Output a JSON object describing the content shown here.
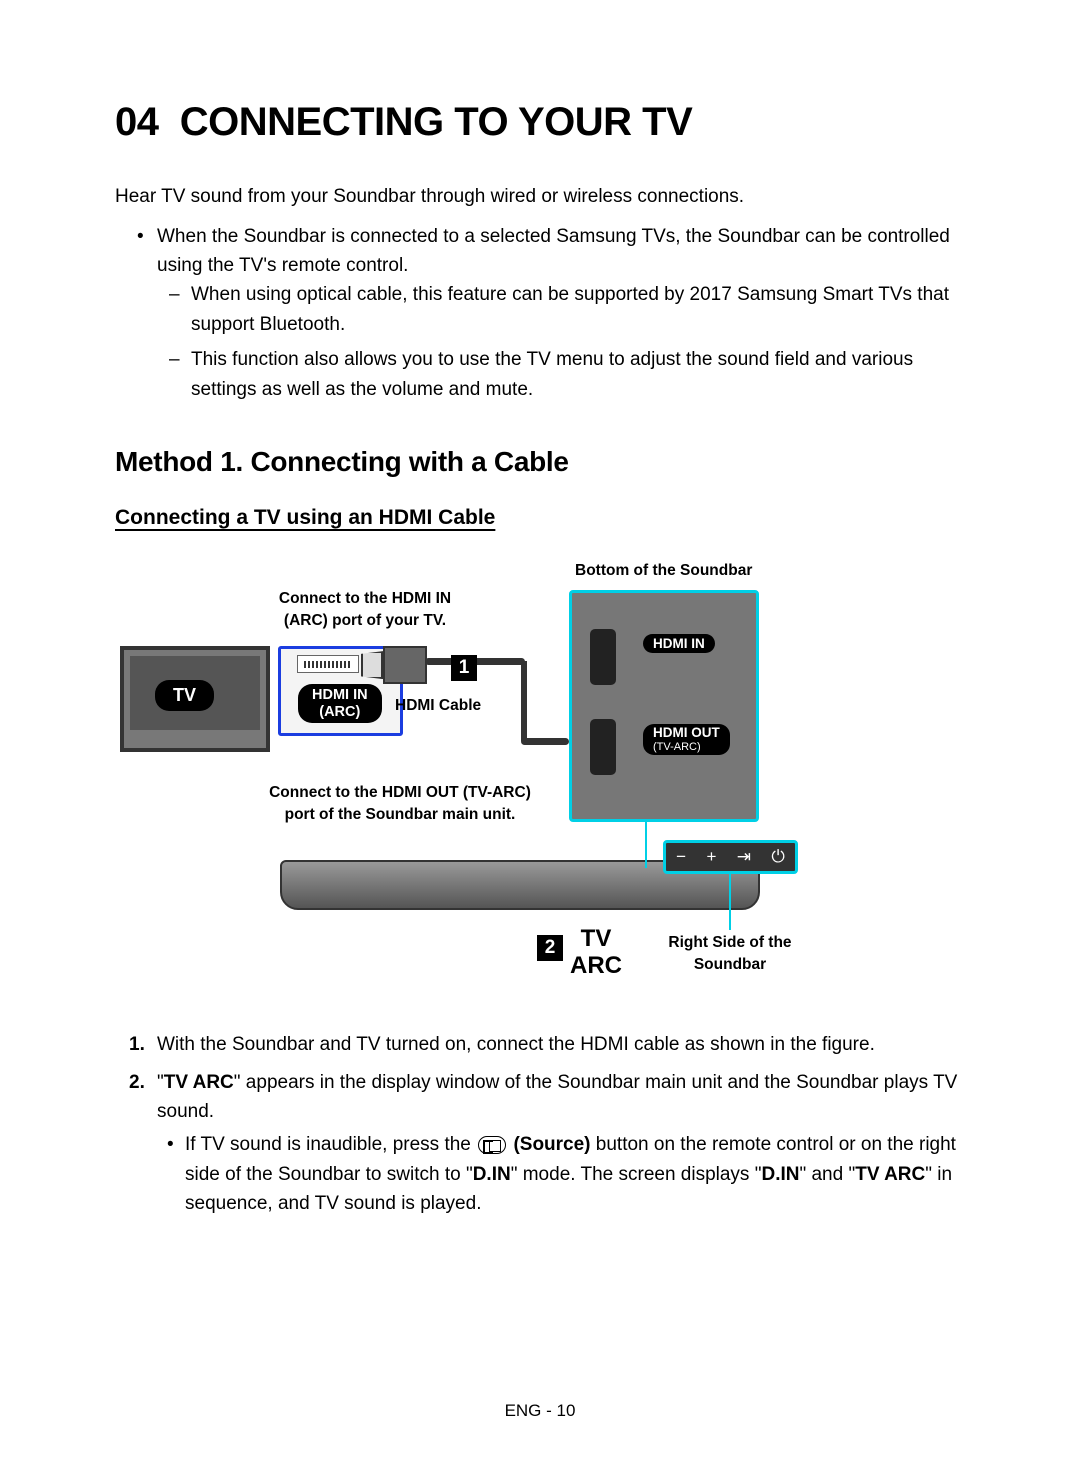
{
  "heading_num": "04",
  "heading_title": "CONNECTING TO YOUR TV",
  "intro": "Hear TV sound from your Soundbar through wired or wireless connections.",
  "bullet1": "When the Soundbar is connected to a selected Samsung TVs, the Soundbar can be controlled using the TV's remote control.",
  "dash1": "When using optical cable, this feature can be supported by 2017 Samsung Smart TVs that support Bluetooth.",
  "dash2": "This function also allows you to use the TV menu to adjust the sound field and various settings as well as the volume and mute.",
  "method_heading": "Method 1. Connecting with a Cable",
  "subsub_heading": "Connecting a TV using an HDMI Cable",
  "diagram": {
    "soundbar_bottom_caption": "Bottom of the Soundbar",
    "connect_hdmi_in_1": "Connect to the HDMI IN",
    "connect_hdmi_in_2": "(ARC) port of your TV.",
    "tv_label": "TV",
    "hdmi_in_arc_1": "HDMI IN",
    "hdmi_in_arc_2": "(ARC)",
    "hdmi_cable": "HDMI Cable",
    "connect_hdmi_out_1": "Connect to the HDMI OUT (TV-ARC)",
    "connect_hdmi_out_2": "port of the Soundbar main unit.",
    "hdmi_in_label": "HDMI IN",
    "hdmi_out_label": "HDMI OUT",
    "hdmi_out_sub": "(TV-ARC)",
    "tv_arc_1": "TV",
    "tv_arc_2": "ARC",
    "right_side_1": "Right Side of the",
    "right_side_2": "Soundbar",
    "step1": "1",
    "step2": "2",
    "ctrl_minus": "−",
    "ctrl_plus": "+",
    "ctrl_source": "⇥",
    "ctrl_power": "⏻"
  },
  "step1_text": "With the Soundbar and TV turned on, connect the HDMI cable as shown in the figure.",
  "step2_pre": "\"",
  "step2_bold1": "TV ARC",
  "step2_post1": "\" appears in the display window of the Soundbar main unit and the Soundbar plays TV sound.",
  "step2_inner_pre": "If TV sound is inaudible, press the ",
  "step2_inner_source": "(Source)",
  "step2_inner_mid1": " button on the remote control or on the right side of the Soundbar to switch to \"",
  "step2_inner_bold2": "D.IN",
  "step2_inner_mid2": "\" mode. The screen displays \"",
  "step2_inner_bold3": "D.IN",
  "step2_inner_mid3": "\" and \"",
  "step2_inner_bold4": "TV ARC",
  "step2_inner_post": "\" in sequence, and TV sound is played.",
  "footer": "ENG - 10"
}
